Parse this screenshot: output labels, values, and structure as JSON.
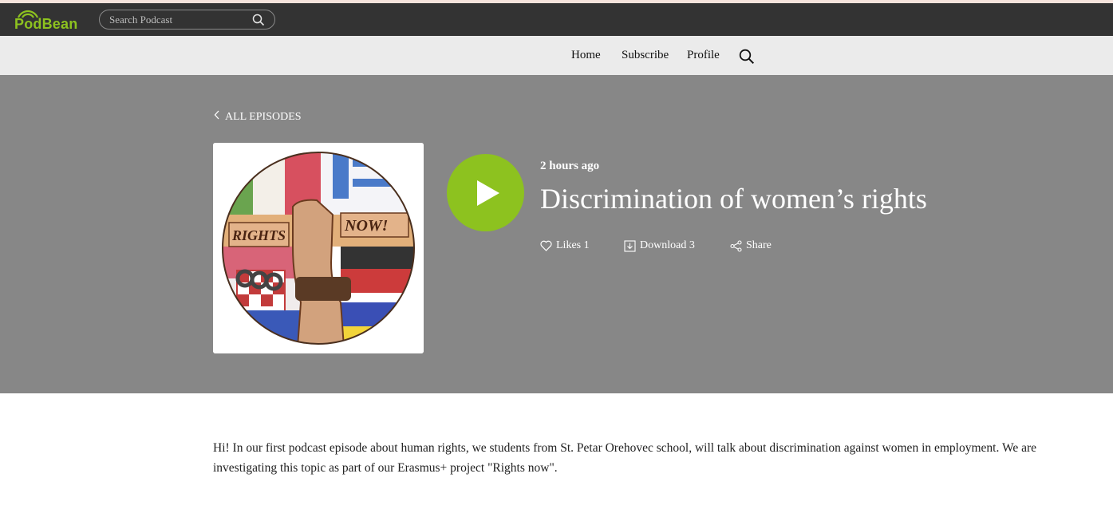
{
  "header": {
    "logo_text": "PodBean",
    "search_placeholder": "Search Podcast",
    "icons": {
      "search": "search-icon",
      "logo_waves": "wifi-waves-icon"
    }
  },
  "nav": {
    "items": [
      {
        "label": "Home"
      },
      {
        "label": "Subscribe"
      },
      {
        "label": "Profile"
      }
    ],
    "search_icon": "search-icon"
  },
  "episode": {
    "back_label": "ALL EPISODES",
    "time_ago": "2 hours ago",
    "title": "Discrimination of women’s rights",
    "actions": {
      "likes": "Likes 1",
      "download": "Download 3",
      "share": "Share"
    },
    "cover_text": "RIGHTS NOW!",
    "description": "Hi! In our first podcast episode about human rights, we students from St. Petar Orehovec school, will talk about discrimination against women in employment. We are investigating this topic as part of our Erasmus+ project \"Rights now\"."
  },
  "colors": {
    "brand_green": "#8dc21f",
    "topbar": "#333333",
    "navbar": "#ebebeb",
    "hero": "#878787"
  }
}
